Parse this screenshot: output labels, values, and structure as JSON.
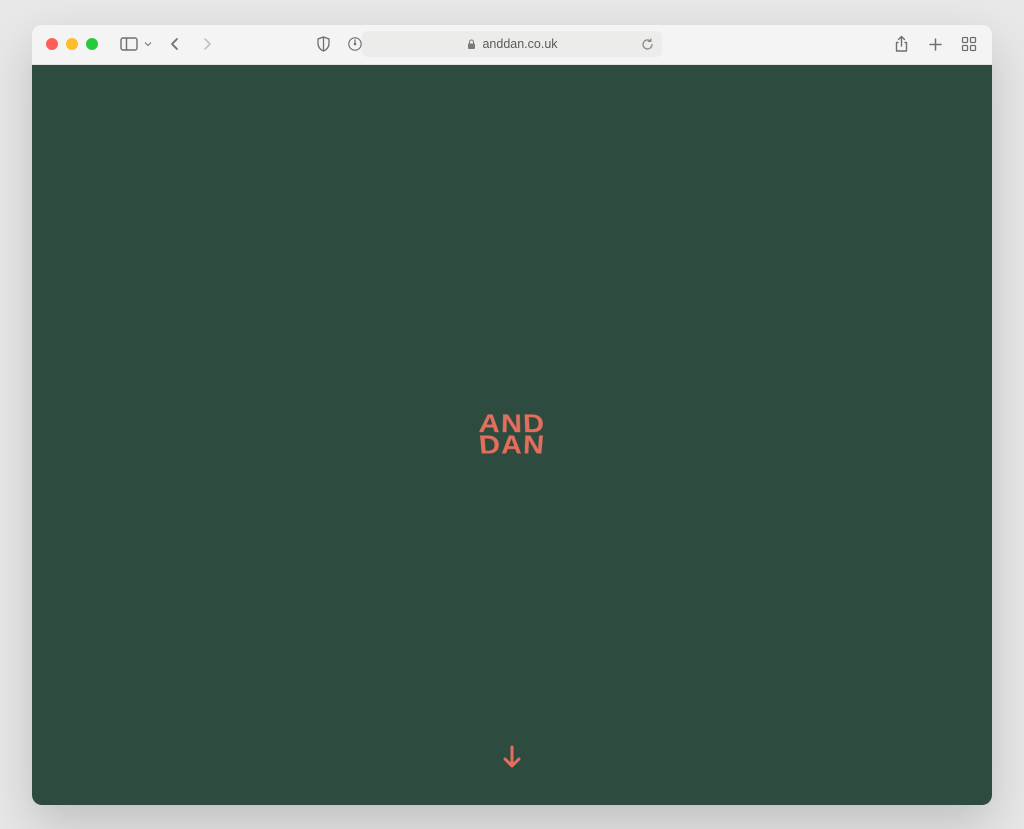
{
  "browser": {
    "url_display": "anddan.co.uk"
  },
  "page": {
    "logo": {
      "line1": "AND",
      "line2": "DAN"
    }
  },
  "icons": {
    "sidebar": "panel-icon",
    "back": "back-icon",
    "forward": "forward-icon",
    "shield": "privacy-shield-icon",
    "text_size": "text-size-icon",
    "lock": "lock-icon",
    "refresh": "refresh-icon",
    "share": "share-icon",
    "new_tab": "new-tab-icon",
    "tabs": "tabs-overview-icon",
    "scroll_down": "scroll-down-arrow-icon"
  },
  "colors": {
    "page_bg": "#2d4b3e",
    "accent": "#e46e5e"
  }
}
